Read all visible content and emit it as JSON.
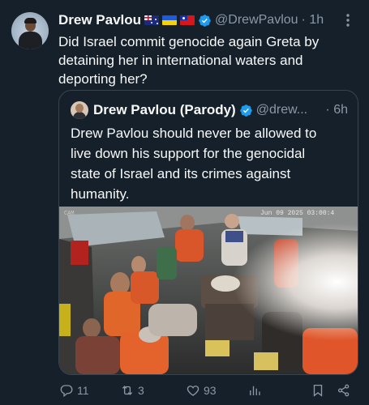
{
  "tweet": {
    "author_name": "Drew Pavlou",
    "author_handle": "@DrewPavlou",
    "time": "· 1h",
    "text": "Did Israel commit genocide again Greta by detaining her in international waters and deporting her?",
    "flags": [
      "australia-flag",
      "ukraine-flag",
      "taiwan-flag"
    ]
  },
  "quote": {
    "author_name": "Drew Pavlou (Parody)",
    "author_handle": "@drew...",
    "time": "· 6h",
    "text": "Drew Pavlou should never be allowed to live down his support for the genocidal state of Israel and its crimes against humanity.",
    "media_timestamp": "Jun 09 2025 03:00:4"
  },
  "actions": {
    "replies": "11",
    "reposts": "3",
    "likes": "93",
    "views": ""
  },
  "colors": {
    "background": "#15202b",
    "text": "#f7f9f9",
    "muted": "#8b98a5",
    "border": "#38444d",
    "verified": "#1d9bf0"
  }
}
